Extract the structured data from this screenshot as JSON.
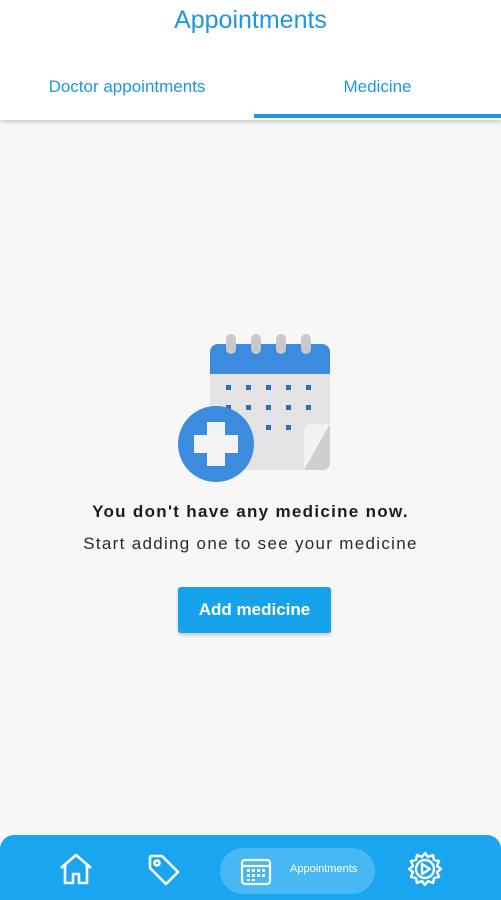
{
  "header": {
    "title": "Appointments",
    "tabs": [
      {
        "label": "Doctor appointments",
        "active": false
      },
      {
        "label": "Medicine",
        "active": true
      }
    ]
  },
  "empty_state": {
    "title": "You don't have any medicine now.",
    "subtitle": "Start adding one to see your medicine",
    "illustration": "calendar-plus-icon"
  },
  "actions": {
    "add_label": "Add medicine"
  },
  "bottom_nav": {
    "items": [
      {
        "icon": "home-icon",
        "label": ""
      },
      {
        "icon": "tag-icon",
        "label": ""
      },
      {
        "icon": "calendar-icon",
        "label": "Appointments",
        "active": true
      },
      {
        "icon": "settings-icon",
        "label": ""
      }
    ]
  },
  "colors": {
    "accent": "#1f97e0",
    "button": "#17a3ec",
    "nav_bg": "#19a5ef",
    "nav_active_bg": "#47b8f3",
    "background": "#f7f7f7"
  }
}
